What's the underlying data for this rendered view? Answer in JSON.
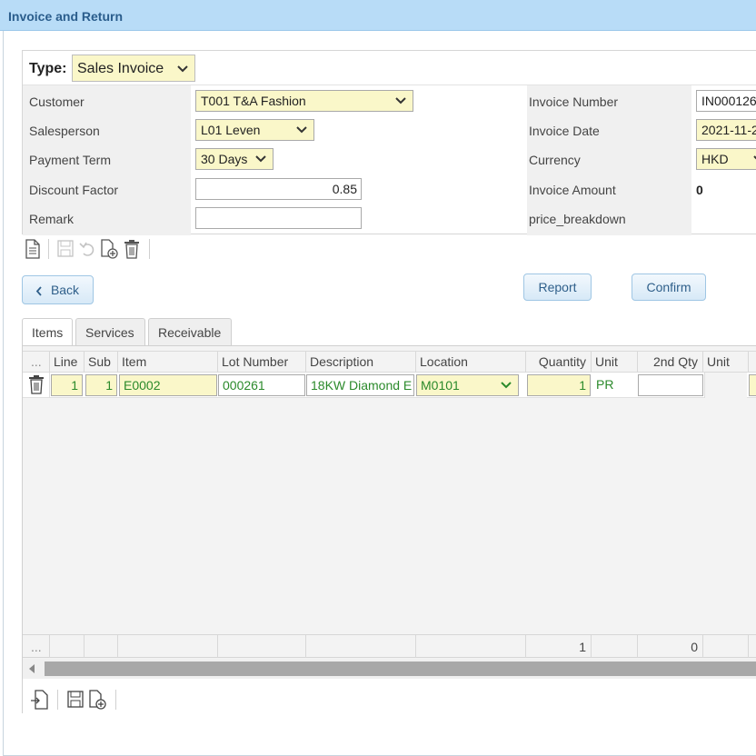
{
  "window": {
    "title": "Invoice and Return"
  },
  "type": {
    "label": "Type:",
    "value": "Sales Invoice"
  },
  "form": {
    "customer": {
      "label": "Customer",
      "value": "T001 T&A Fashion"
    },
    "salesperson": {
      "label": "Salesperson",
      "value": "L01 Leven"
    },
    "payment_term": {
      "label": "Payment Term",
      "value": "30 Days"
    },
    "discount_factor": {
      "label": "Discount Factor",
      "value": "0.85"
    },
    "remark": {
      "label": "Remark",
      "value": ""
    },
    "invoice_number": {
      "label": "Invoice Number",
      "value": "IN000126"
    },
    "invoice_date": {
      "label": "Invoice Date",
      "value": "2021-11-2"
    },
    "currency": {
      "label": "Currency",
      "value": "HKD"
    },
    "invoice_amount": {
      "label": "Invoice Amount",
      "value": "0"
    },
    "price_breakdown": {
      "label": "price_breakdown"
    }
  },
  "buttons": {
    "back": "Back",
    "report": "Report",
    "confirm": "Confirm"
  },
  "tabs": [
    {
      "label": "Items",
      "active": true
    },
    {
      "label": "Services",
      "active": false
    },
    {
      "label": "Receivable",
      "active": false
    }
  ],
  "grid": {
    "columns": [
      "...",
      "Line",
      "Sub",
      "Item",
      "Lot Number",
      "Description",
      "Location",
      "Quantity",
      "Unit",
      "2nd Qty",
      "Unit"
    ],
    "rows": [
      {
        "line": "1",
        "sub": "1",
        "item": "E0002",
        "lot": "000261",
        "description": "18KW Diamond E",
        "location": "M0101",
        "quantity": "1",
        "unit": "PR",
        "qty2": "",
        "unit2": ""
      }
    ],
    "footer": {
      "ellipsis": "...",
      "quantity_total": "1",
      "qty2_total": "0"
    }
  },
  "colors": {
    "accent": "#2a5d8c",
    "yellow_field": "#faf7c9",
    "green_text": "#2b8a2b"
  }
}
